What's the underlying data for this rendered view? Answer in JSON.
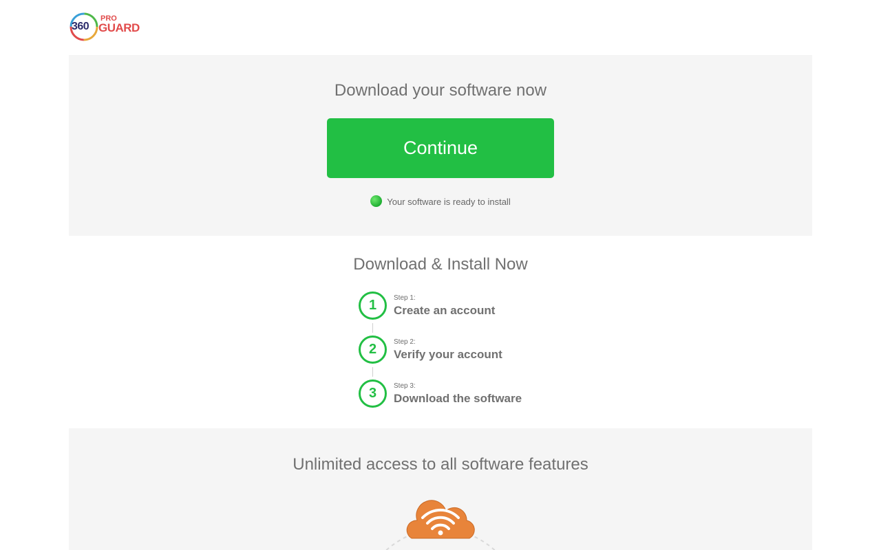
{
  "logo": {
    "number": "360",
    "pro": "PRO",
    "guard": "GUARD"
  },
  "hero": {
    "title": "Download your software now",
    "continue_label": "Continue",
    "status_text": "Your software is ready to install"
  },
  "install": {
    "title": "Download & Install Now",
    "steps": [
      {
        "number": "1",
        "label": "Step 1:",
        "text": "Create an account"
      },
      {
        "number": "2",
        "label": "Step 2:",
        "text": "Verify your account"
      },
      {
        "number": "3",
        "label": "Step 3:",
        "text": "Download the software"
      }
    ]
  },
  "features": {
    "title": "Unlimited access to all software features"
  },
  "colors": {
    "accent_green": "#22bf44",
    "panel_bg": "#f5f5f5",
    "cloud_orange": "#e8843a",
    "logo_red": "#e14b4b"
  }
}
